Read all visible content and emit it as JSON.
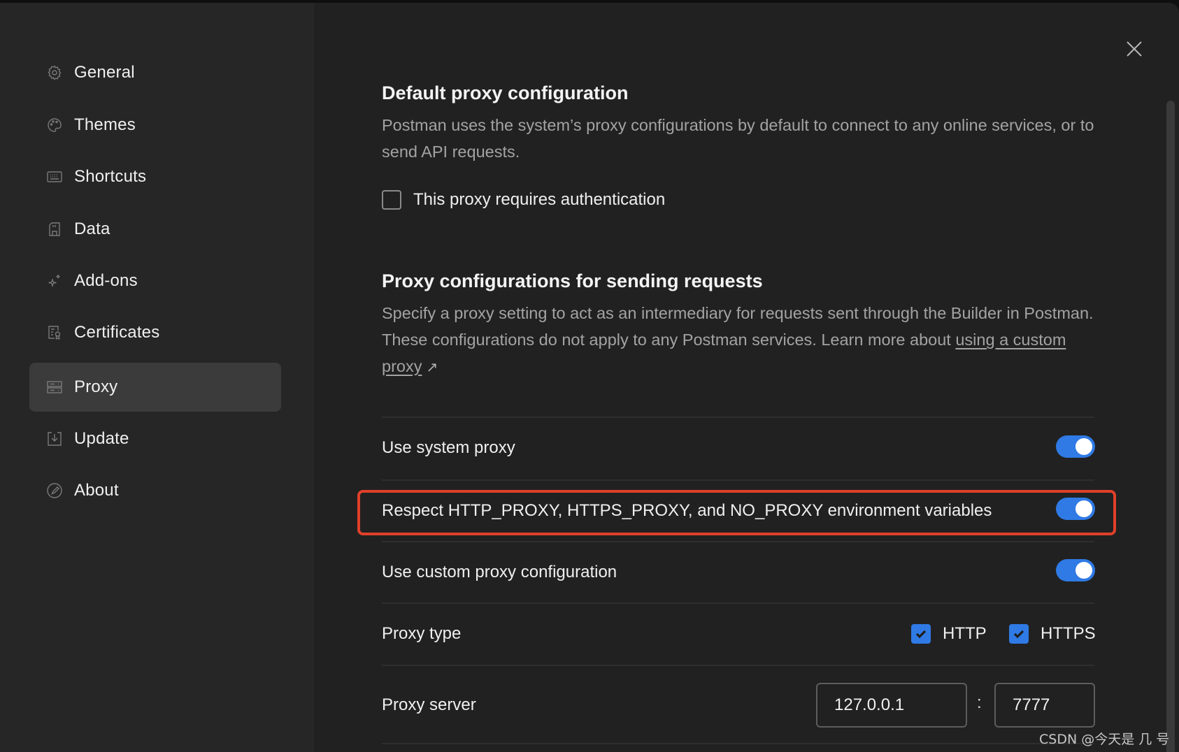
{
  "sidebar": {
    "items": [
      {
        "label": "General",
        "icon": "gear-icon",
        "active": false
      },
      {
        "label": "Themes",
        "icon": "palette-icon",
        "active": false
      },
      {
        "label": "Shortcuts",
        "icon": "keyboard-icon",
        "active": false
      },
      {
        "label": "Data",
        "icon": "save-icon",
        "active": false
      },
      {
        "label": "Add-ons",
        "icon": "sparkle-icon",
        "active": false
      },
      {
        "label": "Certificates",
        "icon": "certificate-icon",
        "active": false
      },
      {
        "label": "Proxy",
        "icon": "server-icon",
        "active": true
      },
      {
        "label": "Update",
        "icon": "download-icon",
        "active": false
      },
      {
        "label": "About",
        "icon": "postman-logo-icon",
        "active": false
      }
    ]
  },
  "default_proxy": {
    "title": "Default proxy configuration",
    "description": "Postman uses the system’s proxy configurations by default to connect to any online services, or to send API requests.",
    "auth_checkbox_label": "This proxy requires authentication",
    "auth_checked": false
  },
  "request_proxy": {
    "title": "Proxy configurations for sending requests",
    "description": "Specify a proxy setting to act as an intermediary for requests sent through the Builder in Postman. These configurations do not apply to any Postman services. Learn more about ",
    "link_text": "using a custom proxy",
    "link_arrow": "↗",
    "rows": {
      "system_proxy": {
        "label": "Use system proxy",
        "enabled": true
      },
      "env_vars": {
        "label": "Respect HTTP_PROXY, HTTPS_PROXY, and NO_PROXY environment variables",
        "enabled": true
      },
      "custom_proxy": {
        "label": "Use custom proxy configuration",
        "enabled": true
      }
    },
    "proxy_type": {
      "label": "Proxy type",
      "options": [
        {
          "label": "HTTP",
          "checked": true
        },
        {
          "label": "HTTPS",
          "checked": true
        }
      ]
    },
    "proxy_server": {
      "label": "Proxy server",
      "host": "127.0.0.1",
      "separator": ":",
      "port": "7777"
    }
  },
  "annotation": {
    "color": "#e0402a"
  },
  "colors": {
    "accent": "#2f7ae5",
    "background": "#212121",
    "sidebar": "#262626",
    "active_item": "#3b3b3b"
  },
  "watermark": "CSDN @今天是 几 号"
}
